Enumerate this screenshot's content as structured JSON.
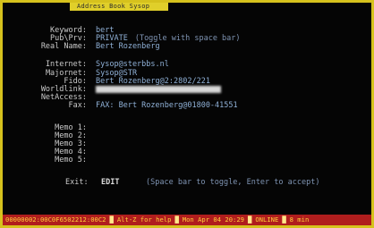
{
  "window": {
    "title": "Address Book Sysop"
  },
  "fields": {
    "keyword": {
      "label": "Keyword:",
      "value": "bert"
    },
    "pub_prv": {
      "label": "Pub\\Prv:",
      "value": "PRIVATE",
      "hint": "(Toggle with space bar)"
    },
    "real_name": {
      "label": "Real Name:",
      "value": "Bert Rozenberg"
    },
    "internet": {
      "label": "Internet:",
      "value": "Sysop@sterbbs.nl"
    },
    "majornet": {
      "label": "Majornet:",
      "value": "Sysop@STR"
    },
    "fido": {
      "label": "Fido:",
      "value": "Bert Rozenberg@2:2802/221"
    },
    "worldlink": {
      "label": "Worldlink:",
      "value": ""
    },
    "netaccess": {
      "label": "NetAccess:",
      "value": ""
    },
    "fax": {
      "label": "Fax:",
      "value": "FAX: Bert Rozenberg@01800-41551"
    },
    "memo1": {
      "label": "Memo 1:",
      "value": ""
    },
    "memo2": {
      "label": "Memo 2:",
      "value": ""
    },
    "memo3": {
      "label": "Memo 3:",
      "value": ""
    },
    "memo4": {
      "label": "Memo 4:",
      "value": ""
    },
    "memo5": {
      "label": "Memo 5:",
      "value": ""
    }
  },
  "exit": {
    "label": "Exit:",
    "value": "EDIT",
    "hint": "(Space bar to toggle, Enter to accept)"
  },
  "statusbar": {
    "session": "00000002:00C0F6502212:00C2",
    "help": "Alt-Z for help",
    "datetime": "Mon Apr 04 20:29",
    "state": "ONLINE",
    "time_left": "8 min"
  },
  "colors": {
    "frame": "#d6c21d",
    "status_bg": "#b01d1d",
    "status_fg": "#ffd23a",
    "label": "#c9c9c9",
    "value": "#8fb0d6"
  }
}
